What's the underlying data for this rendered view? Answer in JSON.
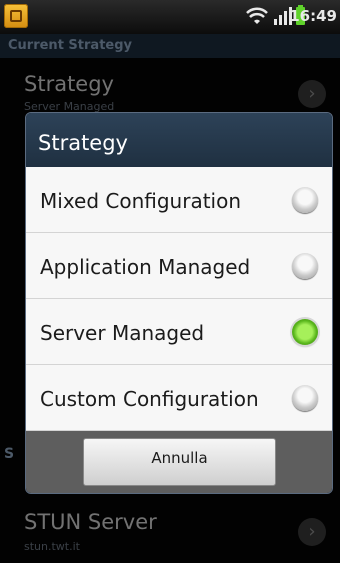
{
  "status_bar": {
    "time": "16:49"
  },
  "background": {
    "section_header": "Current Strategy",
    "strategy_pref": {
      "title": "Strategy",
      "summary": "Server Managed"
    },
    "obscured_section_initial": "S",
    "stun_pref": {
      "title": "STUN Server",
      "summary": "stun.twt.it"
    }
  },
  "dialog": {
    "title": "Strategy",
    "options": [
      {
        "label": "Mixed Configuration",
        "selected": false
      },
      {
        "label": "Application Managed",
        "selected": false
      },
      {
        "label": "Server Managed",
        "selected": true
      },
      {
        "label": "Custom Configuration",
        "selected": false
      }
    ],
    "cancel_label": "Annulla"
  },
  "colors": {
    "accent_selected": "#59b61c",
    "title_bar": "#1f3041"
  }
}
